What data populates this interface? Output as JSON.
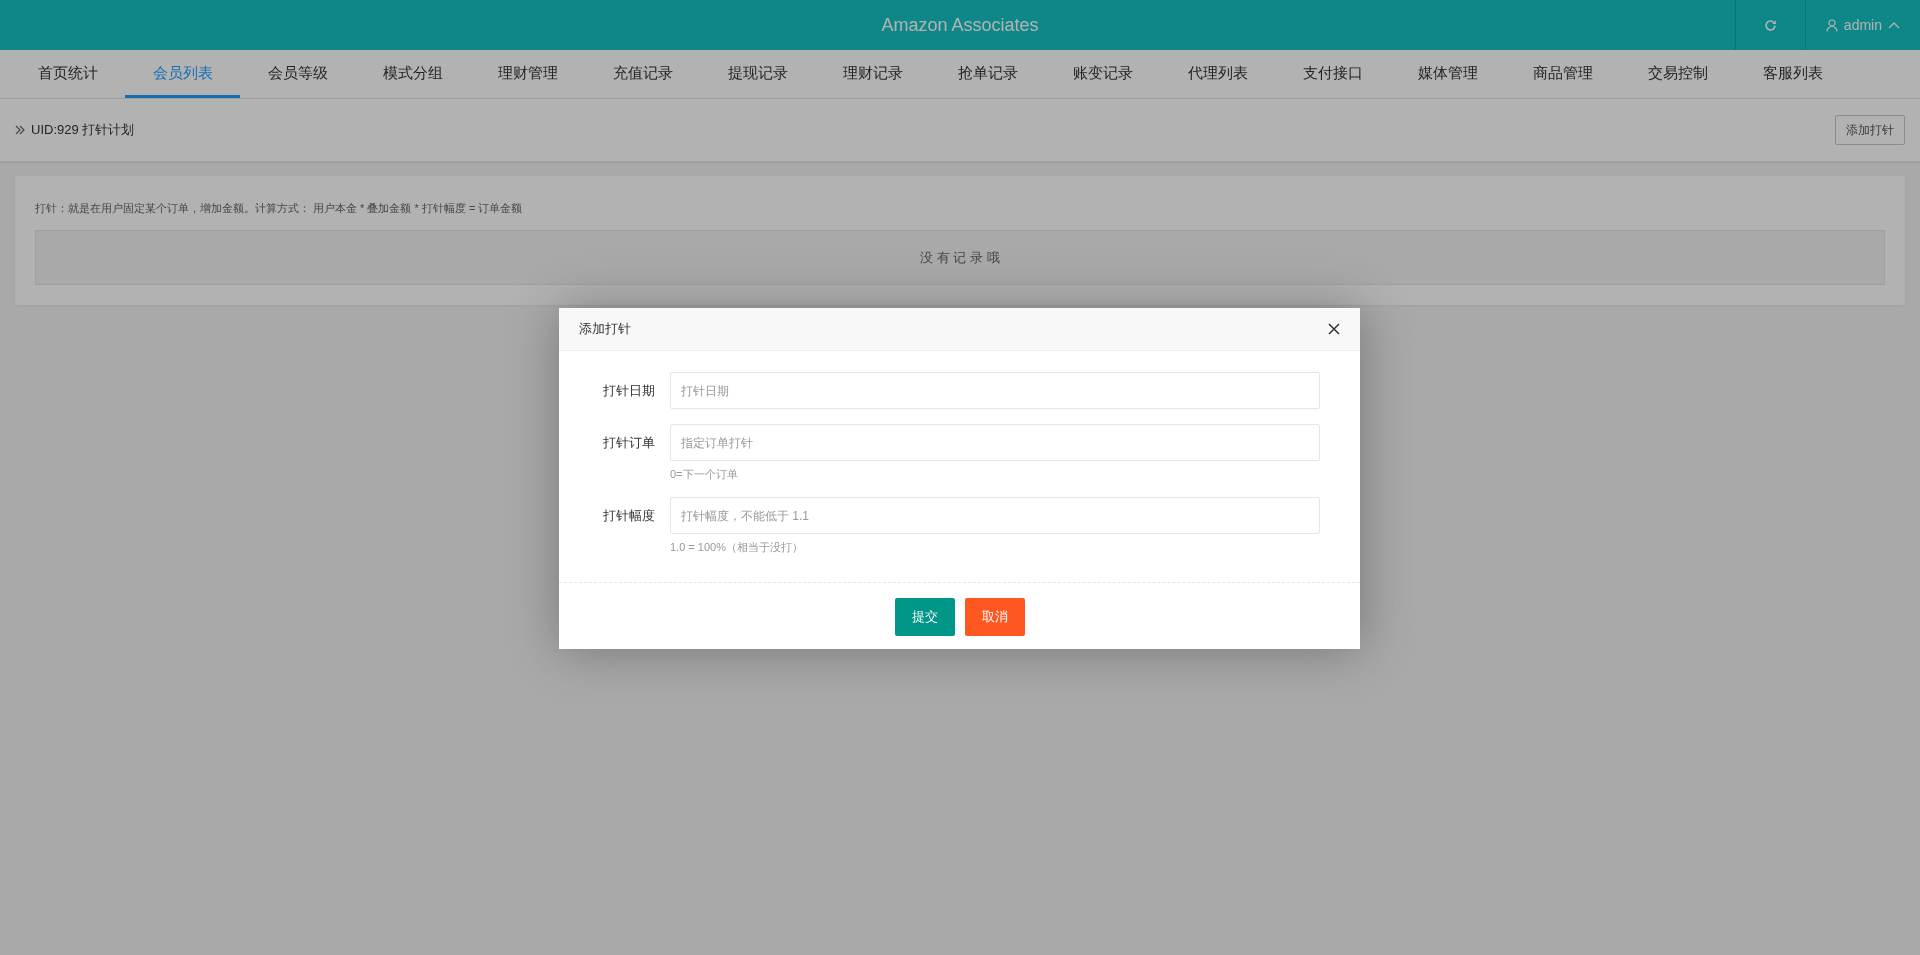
{
  "header": {
    "title": "Amazon Associates",
    "user": "admin"
  },
  "nav": [
    {
      "label": "首页统计",
      "selected": false
    },
    {
      "label": "会员列表",
      "selected": true
    },
    {
      "label": "会员等级",
      "selected": false
    },
    {
      "label": "模式分组",
      "selected": false
    },
    {
      "label": "理财管理",
      "selected": false
    },
    {
      "label": "充值记录",
      "selected": false
    },
    {
      "label": "提现记录",
      "selected": false
    },
    {
      "label": "理财记录",
      "selected": false
    },
    {
      "label": "抢单记录",
      "selected": false
    },
    {
      "label": "账变记录",
      "selected": false
    },
    {
      "label": "代理列表",
      "selected": false
    },
    {
      "label": "支付接口",
      "selected": false
    },
    {
      "label": "媒体管理",
      "selected": false
    },
    {
      "label": "商品管理",
      "selected": false
    },
    {
      "label": "交易控制",
      "selected": false
    },
    {
      "label": "客服列表",
      "selected": false
    }
  ],
  "breadcrumb": {
    "title": "UID:929 打针计划",
    "button": "添加打针"
  },
  "card": {
    "note": "打针：就是在用户固定某个订单，增加金额。计算方式： 用户本金 * 叠加金额 * 打针幅度 = 订单金额",
    "empty": "没 有 记 录 哦"
  },
  "dialog": {
    "title": "添加打针",
    "fields": [
      {
        "label": "打针日期",
        "placeholder": "打针日期"
      },
      {
        "label": "打针订单",
        "placeholder": "指定订单打针",
        "help": "0=下一个订单"
      },
      {
        "label": "打针幅度",
        "placeholder": "打针幅度，不能低于 1.1",
        "help": "1.0 = 100%（相当于没打）"
      }
    ],
    "buttons": [
      {
        "label": "提交",
        "kind": "primary"
      },
      {
        "label": "取消",
        "kind": "danger"
      }
    ]
  }
}
